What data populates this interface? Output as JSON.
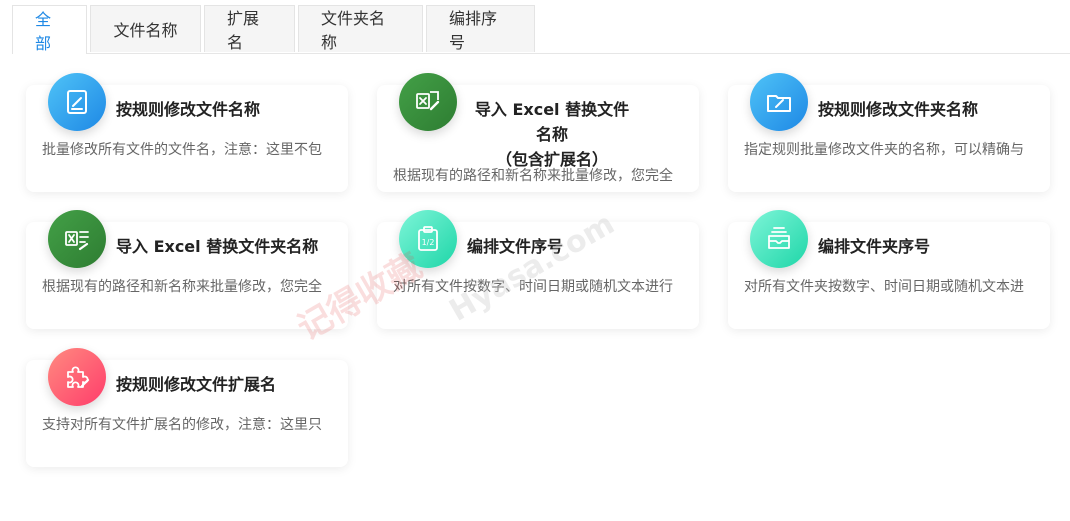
{
  "tabs": [
    {
      "label": "全部",
      "active": true
    },
    {
      "label": "文件名称",
      "active": false
    },
    {
      "label": "扩展名",
      "active": false
    },
    {
      "label": "文件夹名称",
      "active": false
    },
    {
      "label": "编排序号",
      "active": false
    }
  ],
  "cards": [
    {
      "title": "按规则修改文件名称",
      "desc": "批量修改所有文件的文件名，注意：这里不包",
      "icon": "document-edit-icon",
      "color": "#1e88e5"
    },
    {
      "title_line1": "导入 Excel 替换文件名称",
      "title_line2": "（包含扩展名）",
      "desc": "根据现有的路径和新名称来批量修改，您完全",
      "icon": "excel-import-icon",
      "color": "#2e7d32"
    },
    {
      "title": "按规则修改文件夹名称",
      "desc": "指定规则批量修改文件夹的名称，可以精确与",
      "icon": "folder-edit-icon",
      "color": "#1e88e5"
    },
    {
      "title": "导入 Excel 替换文件夹名称",
      "desc": "根据现有的路径和新名称来批量修改，您完全",
      "icon": "excel-list-icon",
      "color": "#2e7d32"
    },
    {
      "title": "编排文件序号",
      "desc": "对所有文件按数字、时间日期或随机文本进行",
      "icon": "clipboard-number-icon",
      "color": "#1ed6a8"
    },
    {
      "title": "编排文件夹序号",
      "desc": "对所有文件夹按数字、时间日期或随机文本进",
      "icon": "folder-stack-icon",
      "color": "#1ed6a8"
    },
    {
      "title": "按规则修改文件扩展名",
      "desc": "支持对所有文件扩展名的修改，注意：这里只",
      "icon": "puzzle-edit-icon",
      "color": "#ff3d6b"
    }
  ],
  "watermark": {
    "text": "记得收藏",
    "text2": "Hyasa.com"
  }
}
